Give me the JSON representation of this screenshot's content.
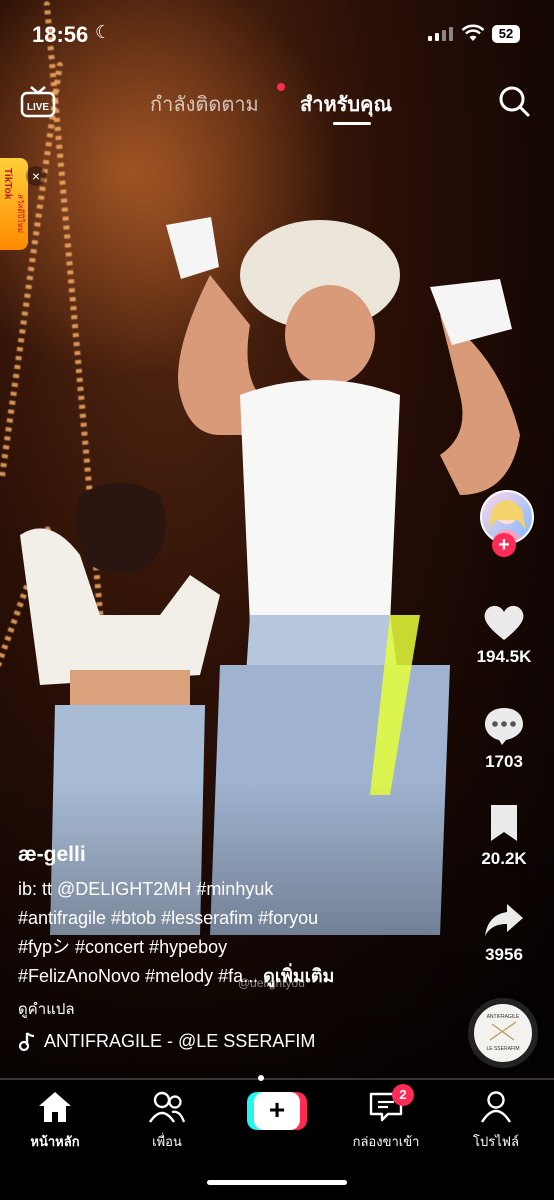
{
  "status_bar": {
    "time": "18:56",
    "battery": "52"
  },
  "top_bar": {
    "live_label": "LIVE",
    "tab_following": "กำลังติดตาม",
    "tab_for_you": "สำหรับคุณ"
  },
  "promo": {
    "brand": "TikTok",
    "subtitle": "สวัสดีปีใหม่"
  },
  "watermark": "@delightyou",
  "actions": {
    "likes": "194.5K",
    "comments": "1703",
    "saves": "20.2K",
    "shares": "3956"
  },
  "disc": {
    "title": "ANTIFRAGILE",
    "artist": "LE SSERAFIM"
  },
  "caption": {
    "username": "æ-gelli",
    "line1": "ib: tt @DELIGHT2MH #minhyuk",
    "line2": "#antifragile #btob #lesserafim #foryou",
    "line3": "#fypシ #concert #hypeboy",
    "line4": "#FelizAnoNovo #melody #fa... ",
    "more": "ดูเพิ่มเติม",
    "translate": "ดูคำแปล",
    "music": "ANTIFRAGILE - @LE SSERAFIM"
  },
  "nav": {
    "home": "หน้าหลัก",
    "friends": "เพื่อน",
    "inbox": "กล่องขาเข้า",
    "inbox_badge": "2",
    "profile": "โปรไฟล์"
  },
  "colors": {
    "accent_red": "#fe2c55",
    "accent_cyan": "#25f4ee"
  }
}
